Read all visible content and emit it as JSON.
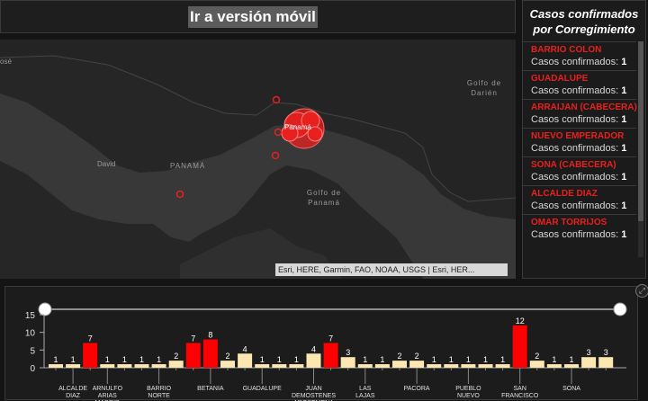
{
  "banner": {
    "mobile_link": "Ir a versión móvil"
  },
  "map": {
    "labels": {
      "country": "PANAMÁ",
      "city": "Panamá",
      "david": "David",
      "golfo_darien": "Golfo de Darién",
      "golfo_panama": "Golfo de Panamá",
      "jose": "osé"
    },
    "attribution": "Esri, HERE, Garmin, FAO, NOAA, USGS | Esri, HER...",
    "marker_color": "#e8201e"
  },
  "right_panel": {
    "title": "Casos confirmados por Corregimiento",
    "count_label": "Casos confirmados:",
    "items": [
      {
        "name": "BARRIO COLON",
        "count": "1"
      },
      {
        "name": "GUADALUPE",
        "count": "1"
      },
      {
        "name": "ARRAIJAN (CABECERA)",
        "count": "1"
      },
      {
        "name": "NUEVO EMPERADOR",
        "count": "1"
      },
      {
        "name": "SONA (CABECERA)",
        "count": "1"
      },
      {
        "name": "ALCALDE DIAZ",
        "count": "1"
      },
      {
        "name": "OMAR TORRIJOS",
        "count": "1"
      }
    ]
  },
  "colors": {
    "bar_default": "#fde7b0",
    "bar_selected": "#ff0000",
    "accent": "#e8201e"
  },
  "chart_data": {
    "type": "bar",
    "ylim": [
      0,
      15
    ],
    "yticks": [
      0,
      5,
      10,
      15
    ],
    "values": [
      1,
      1,
      7,
      1,
      1,
      1,
      1,
      2,
      7,
      8,
      2,
      4,
      1,
      1,
      1,
      4,
      7,
      3,
      1,
      1,
      2,
      2,
      1,
      1,
      1,
      1,
      1,
      12,
      2,
      1,
      1,
      3,
      3
    ],
    "selected": [
      2,
      8,
      9,
      16,
      27
    ],
    "category_labels": [
      {
        "index": 1,
        "lines": [
          "ALCALDE",
          "DIAZ"
        ]
      },
      {
        "index": 3,
        "lines": [
          "ARNULFO",
          "ARIAS",
          "MADRID"
        ]
      },
      {
        "index": 6,
        "lines": [
          "BARRIO",
          "NORTE"
        ]
      },
      {
        "index": 9,
        "lines": [
          "BETANIA"
        ]
      },
      {
        "index": 12,
        "lines": [
          "GUADALUPE"
        ]
      },
      {
        "index": 15,
        "lines": [
          "JUAN",
          "DEMOSTENES",
          "AROSEMENA"
        ]
      },
      {
        "index": 18,
        "lines": [
          "LAS",
          "LAJAS"
        ]
      },
      {
        "index": 21,
        "lines": [
          "PACORA"
        ]
      },
      {
        "index": 24,
        "lines": [
          "PUEBLO",
          "NUEVO"
        ]
      },
      {
        "index": 27,
        "lines": [
          "SAN",
          "FRANCISCO"
        ]
      },
      {
        "index": 30,
        "lines": [
          "SONA"
        ]
      }
    ]
  }
}
